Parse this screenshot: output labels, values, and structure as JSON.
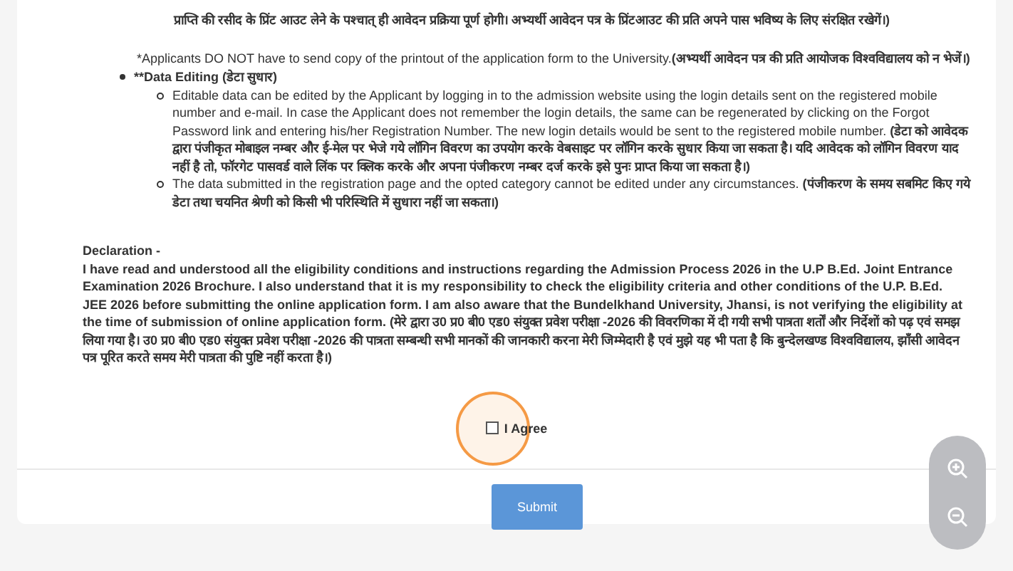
{
  "top_continuation": "**प्राप्ति की रसीद के प्रिंट आउट लेने के पश्चात् ही आवेदन प्रक्रिया पूर्ण होगी। अभ्यर्थी आवेदन पत्र के प्रिंटआउट की प्रति अपने पास भविष्य के लिए संरक्षित रखेगें।)**",
  "note": "*Applicants DO NOT have to send copy of the printout of the application form to the University.**(अभ्यर्थी आवेदन पत्र की प्रति आयोजक विश्वविद्यालय को न भेजें।)**",
  "bullets": [
    {
      "label": "**Data Editing (डेटा सुधार)",
      "children": [
        {
          "text": "Editable data can be edited by the Applicant by logging in to the admission website using the login details sent on the registered mobile number and e-mail. In case the Applicant does not remember the login details, the same can be regenerated by clicking on the Forgot Password link and entering his/her Registration Number. The new login details would be sent to the registered mobile number. **(डेटा को आवेदक द्वारा पंजीकृत मोबाइल नम्बर और ई-मेल पर भेजे गये लॉगिन विवरण का उपयोग करके वेबसाइट पर लॉगिन करके सुधार किया जा सकता है। यदि आवेदक को लॉगिन विवरण याद नहीं है तो, फॉरगेट पासवर्ड वाले लिंक पर क्लिक करके और अपना पंजीकरण नम्बर दर्ज करके इसे पुनः प्राप्त किया जा सकता है।)**"
        },
        {
          "text": "The data submitted in the registration page and the opted category cannot be edited under any circumstances.  **(पंजीकरण के समय सबमिट किए गये डेटा तथा चयनित श्रेणी को किसी भी परिस्थिति में सुधारा नहीं जा सकता।)**"
        }
      ]
    }
  ],
  "declaration": {
    "title": "Declaration -",
    "text": "I have read and understood all the eligibility conditions and instructions regarding the Admission Process 2026 in the U.P B.Ed. Joint Entrance Examination 2026 Brochure. I also understand that it is my responsibility to check the eligibility criteria and other conditions of the U.P. B.Ed. JEE 2026 before submitting the online application form. I am also aware that the Bundelkhand University, Jhansi, is not verifying the eligibility at the time of submission of online application form. (मेरे द्वारा उ0 प्र0 बी0 एड0 संयुक्त प्रवेश परीक्षा -2026 की विवरणिका में दी गयी सभी पात्रता शर्तों और निर्देशों को पढ़ एवं समझ लिया गया है। उ0 प्र0 बी0 एड0 संयुक्त प्रवेश परीक्षा -2026 की पात्रता सम्बन्धी सभी मानकों की जानकारी करना मेरी जिम्मेदारी है एवं मुझे यह भी पता है कि बुन्देलखण्ड विश्वविद्यालय, झाँसी आवेदन पत्र पूरित करते समय मेरी पात्रता की पुष्टि नहीं करता है।)"
  },
  "agree": {
    "label": "I Agree",
    "checked": false
  },
  "submit": "Submit"
}
